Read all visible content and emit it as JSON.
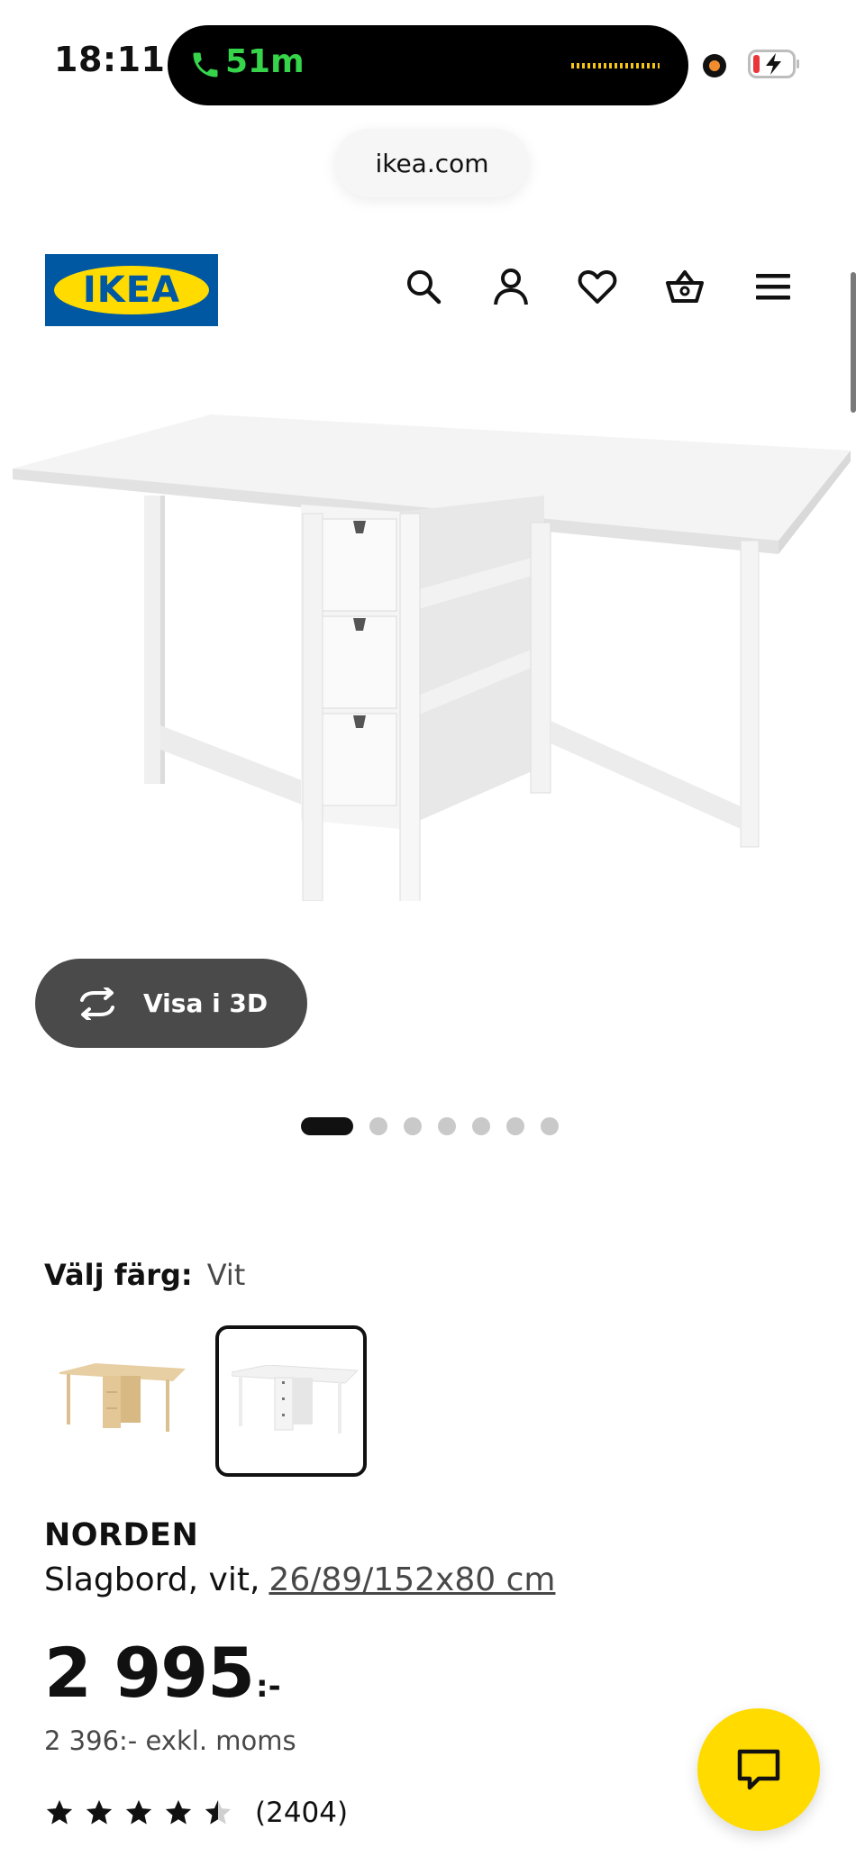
{
  "status_bar": {
    "time": "18:11",
    "call_duration": "51m"
  },
  "browser": {
    "url": "ikea.com"
  },
  "header": {
    "logo_text": "IKEA",
    "icons": [
      "search-icon",
      "account-icon",
      "heart-icon",
      "basket-icon",
      "menu-icon"
    ]
  },
  "gallery": {
    "view_3d_label": "Visa i 3D",
    "image_count": 7,
    "active_index": 0
  },
  "color_picker": {
    "label": "Välj färg:",
    "selected_value": "Vit",
    "options": [
      {
        "name": "birch",
        "selected": false
      },
      {
        "name": "white",
        "selected": true
      }
    ]
  },
  "product": {
    "name": "NORDEN",
    "description": "Slagbord, vit,",
    "dimensions": "26/89/152x80 cm",
    "price": "2 995",
    "price_suffix": ":-",
    "price_ex_vat": "2 396:- exkl. moms",
    "rating": 4.5,
    "review_count": "(2404)"
  },
  "colors": {
    "brand_blue": "#0058a3",
    "brand_yellow": "#ffdb00",
    "button_dark": "#4a4a4a"
  }
}
